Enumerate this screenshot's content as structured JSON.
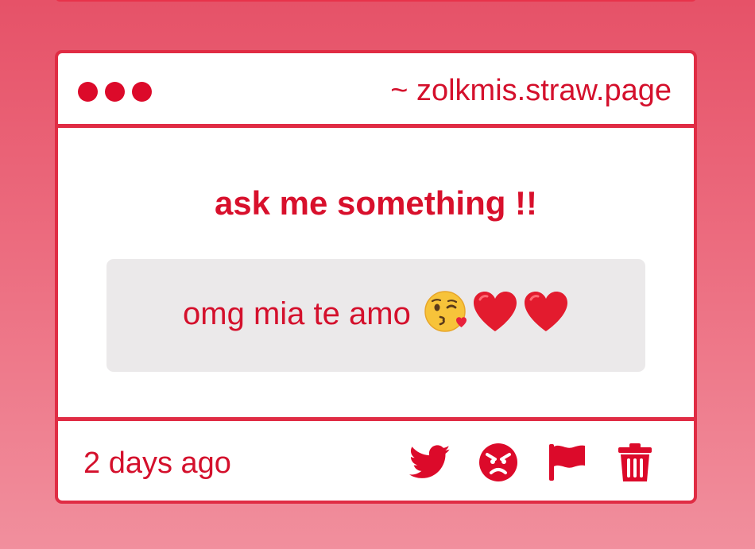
{
  "site": {
    "url_label": "~ zolkmis.straw.page"
  },
  "prompt": {
    "title": "ask me something !!"
  },
  "question": {
    "text": "omg mia te amo",
    "emojis": [
      "kissing-face-with-heart",
      "red-heart",
      "red-heart"
    ]
  },
  "footer": {
    "timestamp": "2 days ago",
    "actions": [
      "twitter-icon",
      "angry-face-icon",
      "flag-icon",
      "trash-icon"
    ]
  },
  "colors": {
    "accent": "#dc0a2a",
    "border": "#e02c44",
    "box_bg": "#ebe9ea",
    "page_bg_top": "#e65268",
    "page_bg_bottom": "#f18f9d"
  }
}
